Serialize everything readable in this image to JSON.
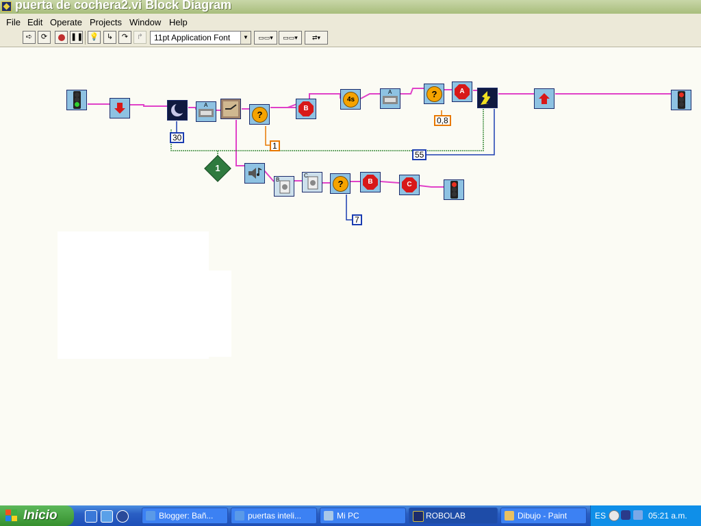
{
  "window": {
    "title": "puerta de cochera2.vi Block Diagram"
  },
  "menu": {
    "items": [
      {
        "label": "File"
      },
      {
        "label": "Edit"
      },
      {
        "label": "Operate"
      },
      {
        "label": "Projects"
      },
      {
        "label": "Window"
      },
      {
        "label": "Help"
      }
    ]
  },
  "toolbar": {
    "font_select": "11pt Application Font",
    "buttons": [
      "run-arrow-icon",
      "run-continuously-icon",
      "abort-icon",
      "pause-icon",
      "highlight-execution-icon",
      "step-into-icon",
      "step-over-icon",
      "step-out-icon"
    ]
  },
  "diagram": {
    "constants": {
      "c30": "30",
      "c1": "1",
      "c55": "55",
      "c08": "0,8",
      "c7": "7",
      "loop_count": "1"
    },
    "block_labels": {
      "wait_4s": "4s",
      "motor_a_1": "A",
      "motor_a_2": "A",
      "motor_b": "B",
      "motor_c": "C",
      "q": "?",
      "stop_a": "A",
      "stop_b": "B",
      "stop_c": "C"
    },
    "colors": {
      "wire_pink": "#e040c8",
      "wire_green": "#3c8c3c",
      "wire_blue": "#1a3cb0",
      "wire_orange": "#e87800"
    }
  },
  "taskbar": {
    "start_label": "Inicio",
    "tasks": [
      {
        "label": "Blogger: Bañ..."
      },
      {
        "label": "puertas inteli..."
      },
      {
        "label": "Mi PC"
      },
      {
        "label": "ROBOLAB"
      },
      {
        "label": "Dibujo - Paint"
      }
    ],
    "language": "ES",
    "clock": "05:21 a.m."
  }
}
